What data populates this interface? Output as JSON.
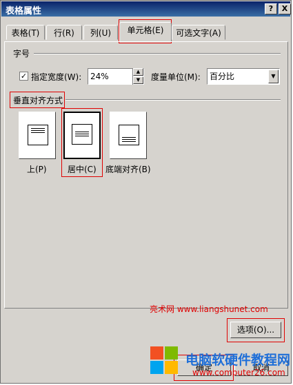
{
  "title_bar": {
    "title": "表格属性",
    "help_label": "?",
    "close_label": "X"
  },
  "tabs": [
    {
      "label": "表格(T)"
    },
    {
      "label": "行(R)"
    },
    {
      "label": "列(U)"
    },
    {
      "label": "单元格(E)"
    },
    {
      "label": "可选文字(A)"
    }
  ],
  "size_section": {
    "heading": "字号",
    "checkbox_mark": "✓",
    "preferred_width_label": "指定宽度(W):",
    "preferred_width_value": "24%",
    "measure_in_label": "度量单位(M):",
    "measure_in_value": "百分比"
  },
  "vertical_alignment": {
    "heading": "垂直对齐方式",
    "options": [
      {
        "label": "上(P)"
      },
      {
        "label": "居中(C)"
      },
      {
        "label": "底端对齐(B)"
      }
    ]
  },
  "buttons": {
    "options": "选项(O)...",
    "ok": "确定",
    "cancel": "取消"
  },
  "watermarks": {
    "top_text": "亮术网 www.liangshunet.com",
    "brand_title": "电脑软硬件教程网",
    "brand_url": "www.computer26.com"
  },
  "colors": {
    "accent_red": "#e00000",
    "watermark_blue": "#1f6fd8"
  }
}
